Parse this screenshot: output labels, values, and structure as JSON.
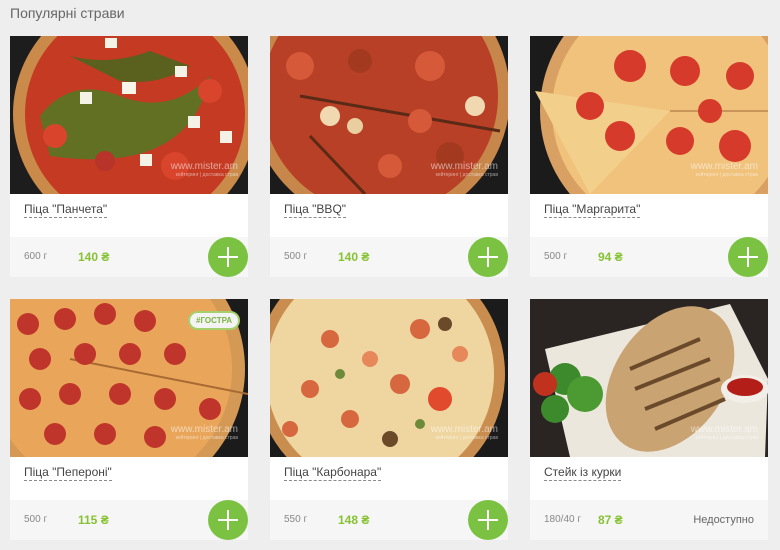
{
  "section": {
    "title": "Популярні страви"
  },
  "watermark": {
    "site": "www.mister.am",
    "tagline": "кейтеринг | доставка страв"
  },
  "products": [
    {
      "name": "Піца \"Панчета\"",
      "weight": "600 г",
      "price": "140 ₴",
      "action": "add",
      "image": "pizza-pancetta"
    },
    {
      "name": "Піца \"BBQ\"",
      "weight": "500 г",
      "price": "140 ₴",
      "action": "add",
      "image": "pizza-bbq"
    },
    {
      "name": "Піца \"Маргарита\"",
      "weight": "500 г",
      "price": "94 ₴",
      "action": "add",
      "image": "pizza-margherita"
    },
    {
      "name": "Піца \"Пепероні\"",
      "weight": "500 г",
      "price": "115 ₴",
      "action": "add",
      "image": "pizza-pepperoni",
      "badge": "#ГОСТРА"
    },
    {
      "name": "Піца \"Карбонара\"",
      "weight": "550 г",
      "price": "148 ₴",
      "action": "add",
      "image": "pizza-carbonara"
    },
    {
      "name": "Стейк із курки",
      "weight": "180/40 г",
      "price": "87 ₴",
      "status": "Недоступно",
      "image": "chicken-steak"
    }
  ],
  "colors": {
    "accent": "#7cc242",
    "price": "#86c232",
    "background": "#eeeeee"
  }
}
